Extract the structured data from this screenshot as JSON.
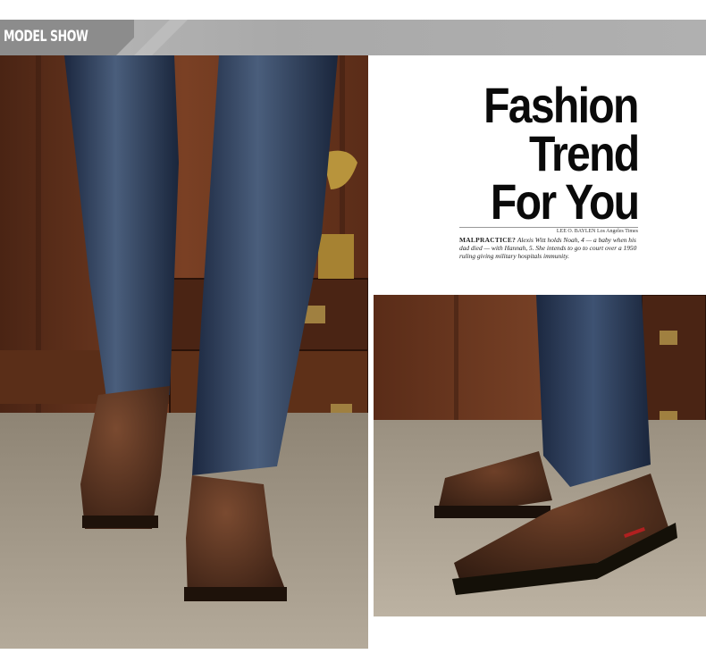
{
  "header": {
    "title": "MODEL SHOW"
  },
  "magazine": {
    "line1": "Fashion",
    "line2": "Trend",
    "line3": "For You",
    "byline": "LEE O. BAYLEN Los Angeles Times",
    "caption_keyword": "MALPRACTICE?",
    "caption_text": "Alexis Witt holds Noah, 4 — a baby when his dad died — with Hannah, 5. She intends to go to court over a 1950 ruling giving military hospitals immunity."
  },
  "colors": {
    "header_bg": "#aaaaaa",
    "header_text": "#ffffff",
    "jeans": "#2a3a55",
    "shoe": "#4a2c1c",
    "wood": "#6b3a22",
    "carpet": "#a89d8e"
  }
}
